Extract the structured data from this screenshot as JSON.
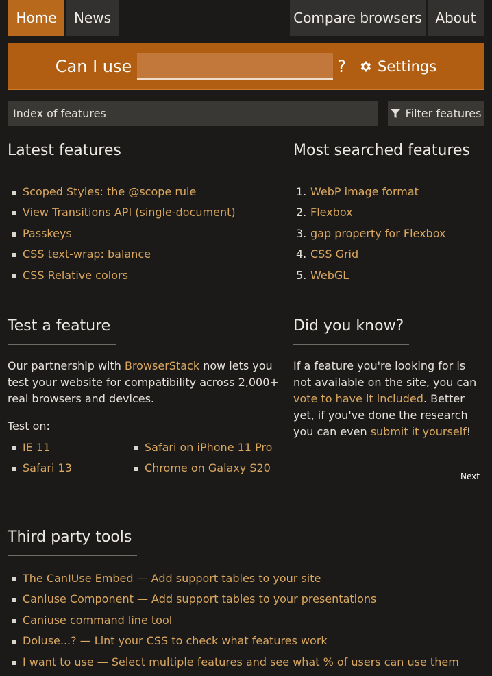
{
  "nav": {
    "home": "Home",
    "news": "News",
    "compare": "Compare browsers",
    "about": "About"
  },
  "search": {
    "label": "Can I use",
    "value": "",
    "placeholder": "",
    "qmark": "?",
    "settings": "Settings"
  },
  "index": {
    "label": "Index of features",
    "filter": "Filter features"
  },
  "latest": {
    "title": "Latest features",
    "items": [
      "Scoped Styles: the @scope rule",
      "View Transitions API (single-document)",
      "Passkeys",
      "CSS text-wrap: balance",
      "CSS Relative colors"
    ]
  },
  "most_searched": {
    "title": "Most searched features",
    "items": [
      {
        "n": "1.",
        "label": "WebP image format"
      },
      {
        "n": "2.",
        "label": "Flexbox"
      },
      {
        "n": "3.",
        "label": "gap property for Flexbox"
      },
      {
        "n": "4.",
        "label": "CSS Grid"
      },
      {
        "n": "5.",
        "label": "WebGL"
      }
    ]
  },
  "test": {
    "title": "Test a feature",
    "p_before": "Our partnership with ",
    "p_link": "BrowserStack",
    "p_after": " now lets you test your website for compatibility across 2,000+ real browsers and devices.",
    "test_on": "Test on:",
    "col1": [
      "IE 11",
      "Safari 13"
    ],
    "col2": [
      "Safari on iPhone 11 Pro",
      "Chrome on Galaxy S20"
    ]
  },
  "did_you_know": {
    "title": "Did you know?",
    "t1": "If a feature you're looking for is not available on the site, you can ",
    "l1": "vote to have it included",
    "t2": ". Better yet, if you've done the research you can even ",
    "l2": "submit it yourself",
    "t3": "!",
    "next": "Next"
  },
  "third_party": {
    "title": "Third party tools",
    "items": [
      "The CanIUse Embed — Add support tables to your site",
      "Caniuse Component — Add support tables to your presentations",
      "Caniuse command line tool",
      "Doiuse...? — Lint your CSS to check what features work",
      "I want to use — Select multiple features and see what % of users can use them"
    ]
  },
  "colors": {
    "accent": "#b8691c",
    "link": "#d9a760",
    "background": "#1b1a18"
  }
}
